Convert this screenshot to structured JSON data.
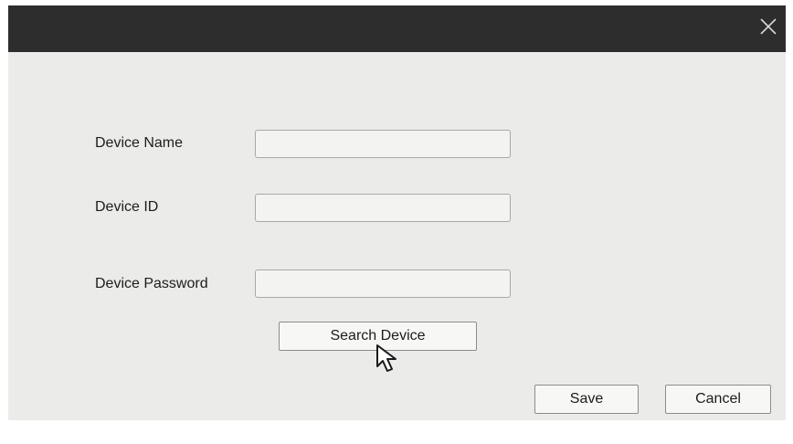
{
  "window": {
    "close_icon": "close-icon"
  },
  "form": {
    "device_name_label": "Device Name",
    "device_name_value": "",
    "device_id_label": "Device ID",
    "device_id_value": "",
    "device_password_label": "Device Password",
    "device_password_value": ""
  },
  "buttons": {
    "search_device": "Search Device",
    "save": "Save",
    "cancel": "Cancel"
  },
  "cursor": {
    "icon": "pointer-arrow-icon"
  },
  "colors": {
    "titlebar": "#2d2d2d",
    "dialog_background": "#ebebe9",
    "field_background": "#f3f3f1"
  }
}
